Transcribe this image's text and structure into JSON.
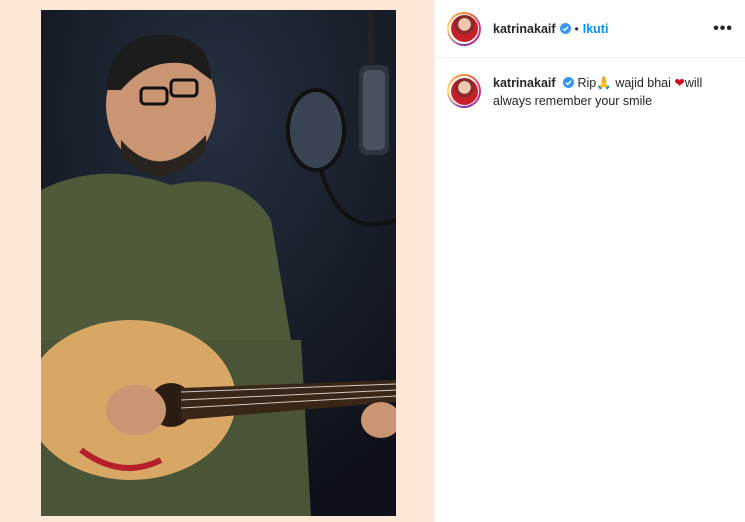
{
  "post": {
    "username": "katrinakaif",
    "dot": "•",
    "follow_label": "Ikuti",
    "more_label": "•••",
    "caption": {
      "username": "katrinakaif",
      "text_part1": "Rip",
      "emoji_pray": "🙏",
      "text_part2": " wajid bhai ",
      "emoji_heart": "❤",
      "text_part3": "will always remember your smile"
    }
  },
  "colors": {
    "accent": "#0095f6",
    "verified": "#3897f0",
    "heart": "#d0021b"
  },
  "icons": [
    "verified-badge-icon",
    "more-options-icon",
    "avatar-image"
  ]
}
